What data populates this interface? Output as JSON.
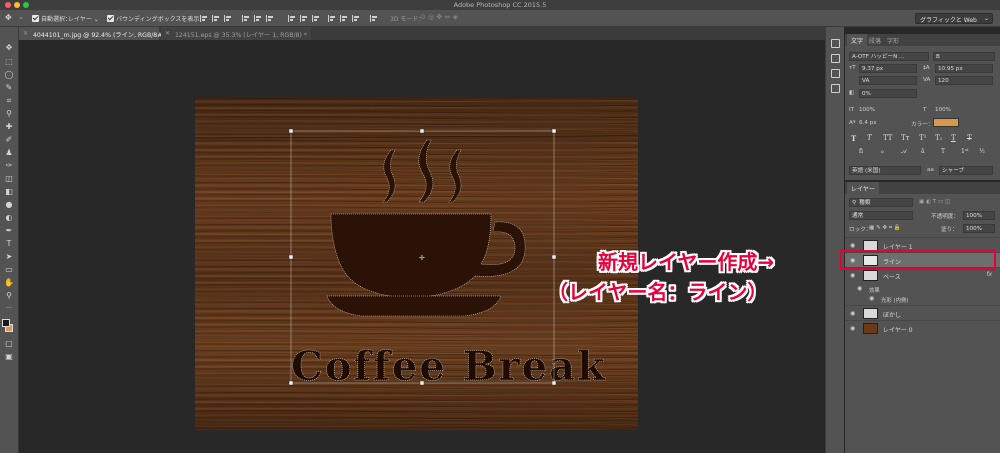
{
  "window": {
    "title": "Adobe Photoshop CC 2015.5"
  },
  "options_bar": {
    "auto_select_label": "自動選択：",
    "auto_select_target": "レイヤー",
    "bounding_box_label": "バウンディングボックスを表示",
    "mode_3d_label": "3D モード：",
    "workspace": "グラフィックと Web"
  },
  "tabs": [
    {
      "label": "4044101_m.jpg @ 92.4% (ライン, RGB/8#) *"
    },
    {
      "label": "124151.eps @ 35.3% (レイヤー 1, RGB/8) *"
    }
  ],
  "canvas": {
    "artwork_text": "Coffee Break",
    "wood_color": "#5a3218"
  },
  "char_panel": {
    "tabs": [
      "文字",
      "段落",
      "字形"
    ],
    "font_family": "A-OTF ハッピーN ...",
    "font_style": "B",
    "font_size": "9.37 px",
    "leading": "10.95 px",
    "kerning": "VA",
    "tracking": "120",
    "tsume": "0%",
    "vertical_scale": "100%",
    "horizontal_scale": "100%",
    "baseline_shift": "6.4 px",
    "color_label": "カラー：",
    "color_swatch": "#d8994a",
    "language": "英語 (米国)",
    "aa_label": "aa",
    "antialias": "シャープ"
  },
  "layers_panel": {
    "tab": "レイヤー",
    "filter_label": "種類",
    "blend_mode": "通常",
    "opacity_label": "不透明度：",
    "opacity": "100%",
    "lock_label": "ロック：",
    "fill_label": "塗り：",
    "fill": "100%",
    "layers": [
      {
        "name": "レイヤー 1"
      },
      {
        "name": "ライン"
      },
      {
        "name": "ベース",
        "fx": "fx"
      },
      {
        "name": "ぼかし"
      },
      {
        "name": "レイヤー 0"
      }
    ],
    "effects_label": "効果",
    "effect_name": "光彩 (内側)"
  },
  "annotation": {
    "line1": "新規レイヤー作成→",
    "line2": "（レイヤー名：ライン）",
    "color": "#e8003a"
  }
}
